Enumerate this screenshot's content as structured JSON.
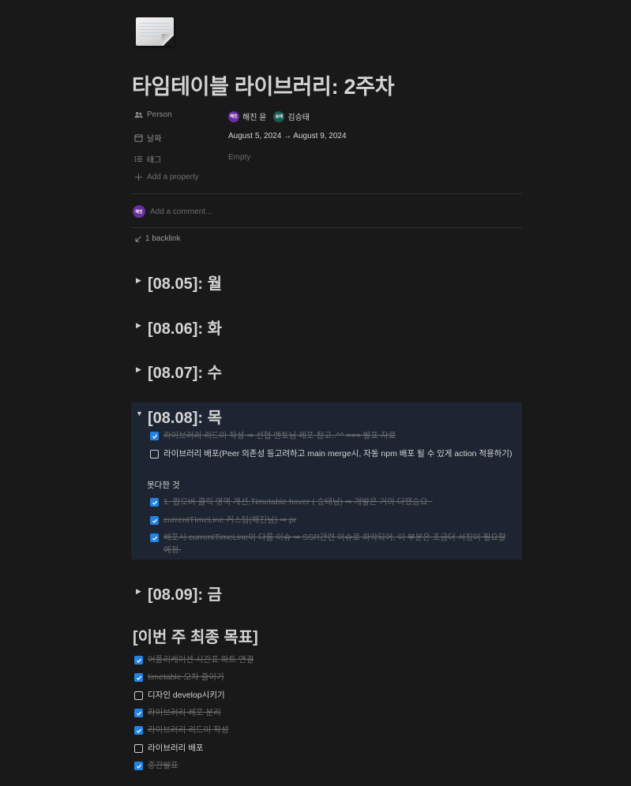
{
  "title": "타임테이블 라이브러리: 2주차",
  "properties": {
    "person": {
      "label": "Person",
      "people": [
        {
          "avatar": "해진",
          "name": "해진 윤",
          "color": "#6a2fa0"
        },
        {
          "avatar": "승태",
          "name": "김승태",
          "color": "#1c5c52"
        }
      ]
    },
    "date": {
      "label": "날짜",
      "value": "August 5, 2024 → August 9, 2024"
    },
    "tags": {
      "label": "태그",
      "value": "Empty"
    },
    "add_property": "Add a property"
  },
  "comment": {
    "avatar": "해진",
    "placeholder": "Add a comment..."
  },
  "backlink": "1 backlink",
  "days": [
    {
      "title": "[08.05]: 월",
      "open": false
    },
    {
      "title": "[08.06]: 화",
      "open": false
    },
    {
      "title": "[08.07]: 수",
      "open": false
    },
    {
      "title": "[08.08]: 목",
      "open": true
    },
    {
      "title": "[08.09]: 금",
      "open": false
    }
  ],
  "thursday": {
    "tasks": [
      {
        "text": "라이브러리 리드미 작성 ⇒ 선협 멘토님 레포 참고..^^ === 발표 자료",
        "checked": true
      },
      {
        "text": "라이브러리 배포(Peer 의존성 등고려하고 main merge시, 자동 npm 배포 될 수 있게 action 적용하기)",
        "checked": false
      }
    ],
    "unfinished_label": "못다한 것",
    "unfinished": [
      {
        "text": "1. 팝오버 클릭 영역 개선,Timetable hover ( 승태님) ⇒ 개발은 거의 다됐슴요~",
        "checked": true
      },
      {
        "text": "currentTImeLine 커스텀(해진님) ⇒ pr",
        "checked": true
      },
      {
        "text": "배포시 currentTimeLine이 다름 이슈 ⇒ SSR관련 이슈로 파악되어, 이 부분은 조금더 서칭이 필요할 예정.",
        "checked": true
      }
    ]
  },
  "weekly_goals": {
    "heading": "[이번 주 최종 목표]",
    "items": [
      {
        "text": "어플리케이션 시간표 파트 연결",
        "checked": true
      },
      {
        "text": "timetable 오차 줄이기",
        "checked": true
      },
      {
        "text": "디자인 develop시키기",
        "checked": false
      },
      {
        "text": "라이브러리 레포 분리",
        "checked": true
      },
      {
        "text": "라이브러리 리드미 작성",
        "checked": true
      },
      {
        "text": "라이브러리 배포",
        "checked": false
      },
      {
        "text": "중간발표",
        "checked": true
      }
    ]
  }
}
